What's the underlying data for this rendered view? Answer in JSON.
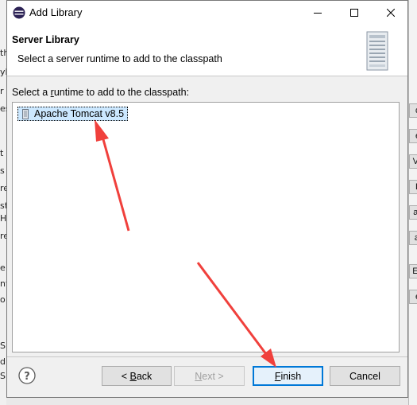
{
  "window": {
    "title": "Add Library"
  },
  "header": {
    "title": "Server Library",
    "description": "Select a server runtime to add to the classpath"
  },
  "list": {
    "label_pre": "Select a ",
    "label_mnemonic": "r",
    "label_post": "untime to add to the classpath:",
    "items": [
      {
        "label": "Apache Tomcat v8.5",
        "selected": true
      }
    ]
  },
  "buttons": {
    "back": {
      "pre": "< ",
      "mnemonic": "B",
      "post": "ack"
    },
    "next": {
      "pre": "",
      "mnemonic": "N",
      "post": "ext >"
    },
    "finish": {
      "pre": "",
      "mnemonic": "F",
      "post": "inish"
    },
    "cancel": "Cancel"
  },
  "background_window": {
    "left_letters": [
      "th",
      "yl",
      "r",
      "es",
      "t",
      "s",
      "re",
      "st",
      "Hi",
      "re",
      "e",
      "nt",
      "o",
      "S",
      "di",
      "S"
    ],
    "right_buttons": [
      "d",
      "e",
      "Va",
      "L",
      "as",
      "al",
      "Ed",
      "e"
    ]
  },
  "colors": {
    "annotation_arrow": "#f0403c",
    "selection": "#cce8ff",
    "default_button_border": "#0078d7"
  }
}
